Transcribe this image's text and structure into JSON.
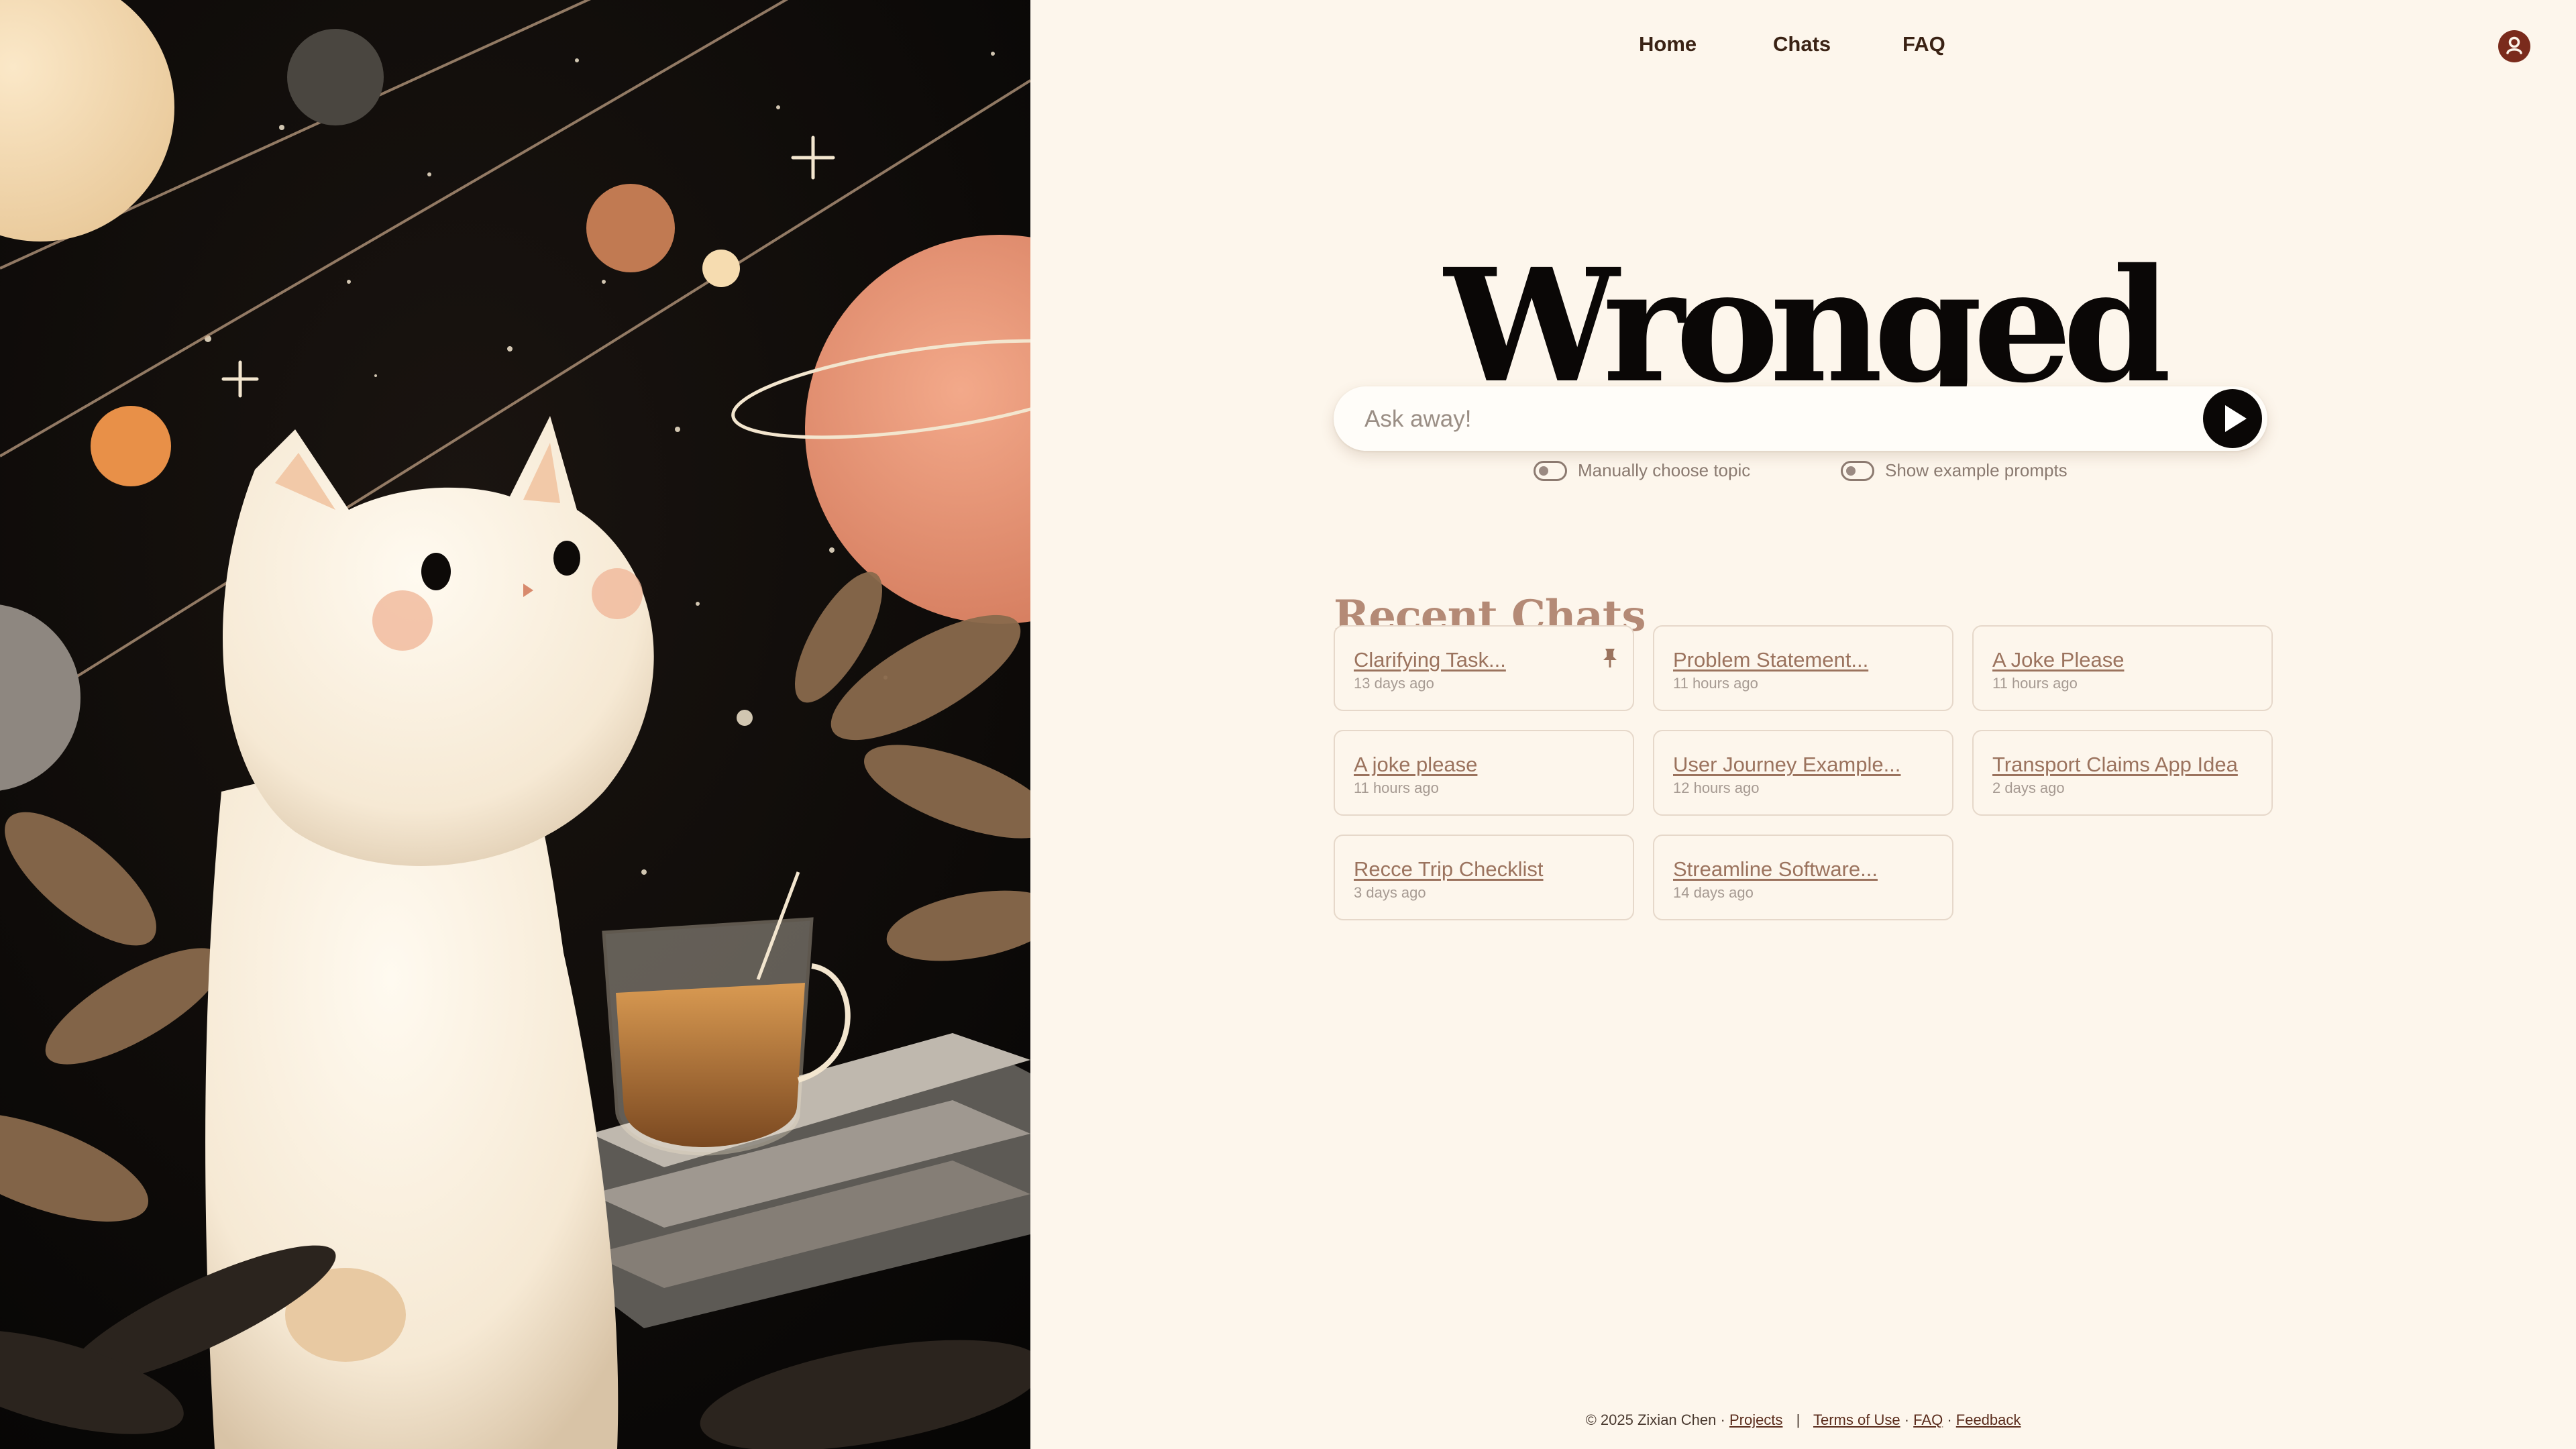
{
  "nav": {
    "home": "Home",
    "chats": "Chats",
    "faq": "FAQ"
  },
  "brand": "Wronged",
  "search": {
    "placeholder": "Ask away!"
  },
  "toggles": {
    "manual_topic": "Manually choose topic",
    "example_prompts": "Show example prompts"
  },
  "recent": {
    "title": "Recent Chats",
    "items": [
      {
        "title": "Clarifying Task...",
        "time": "13 days ago",
        "pinned": true
      },
      {
        "title": "Problem Statement...",
        "time": "11 hours ago"
      },
      {
        "title": "A Joke Please",
        "time": "11 hours ago"
      },
      {
        "title": "A joke please",
        "time": "11 hours ago"
      },
      {
        "title": "User Journey Example...",
        "time": "12 hours ago"
      },
      {
        "title": "Transport Claims App Idea",
        "time": "2 days ago"
      },
      {
        "title": "Recce Trip Checklist",
        "time": "3 days ago"
      },
      {
        "title": "Streamline Software...",
        "time": "14 days ago"
      }
    ]
  },
  "footer": {
    "copyright": "© 2025 Zixian Chen ·",
    "projects": "Projects",
    "separator": "|",
    "terms": "Terms of Use",
    "dot1": "·",
    "faq": "FAQ",
    "dot2": "·",
    "feedback": "Feedback"
  },
  "icons": {
    "avatar": "user-avatar-icon",
    "send": "play-send-icon",
    "pin": "pin-icon"
  },
  "colors": {
    "background": "#fdf6ec",
    "accent": "#b48a76",
    "brand": "#0a0706",
    "avatar": "#7a2b1c"
  }
}
